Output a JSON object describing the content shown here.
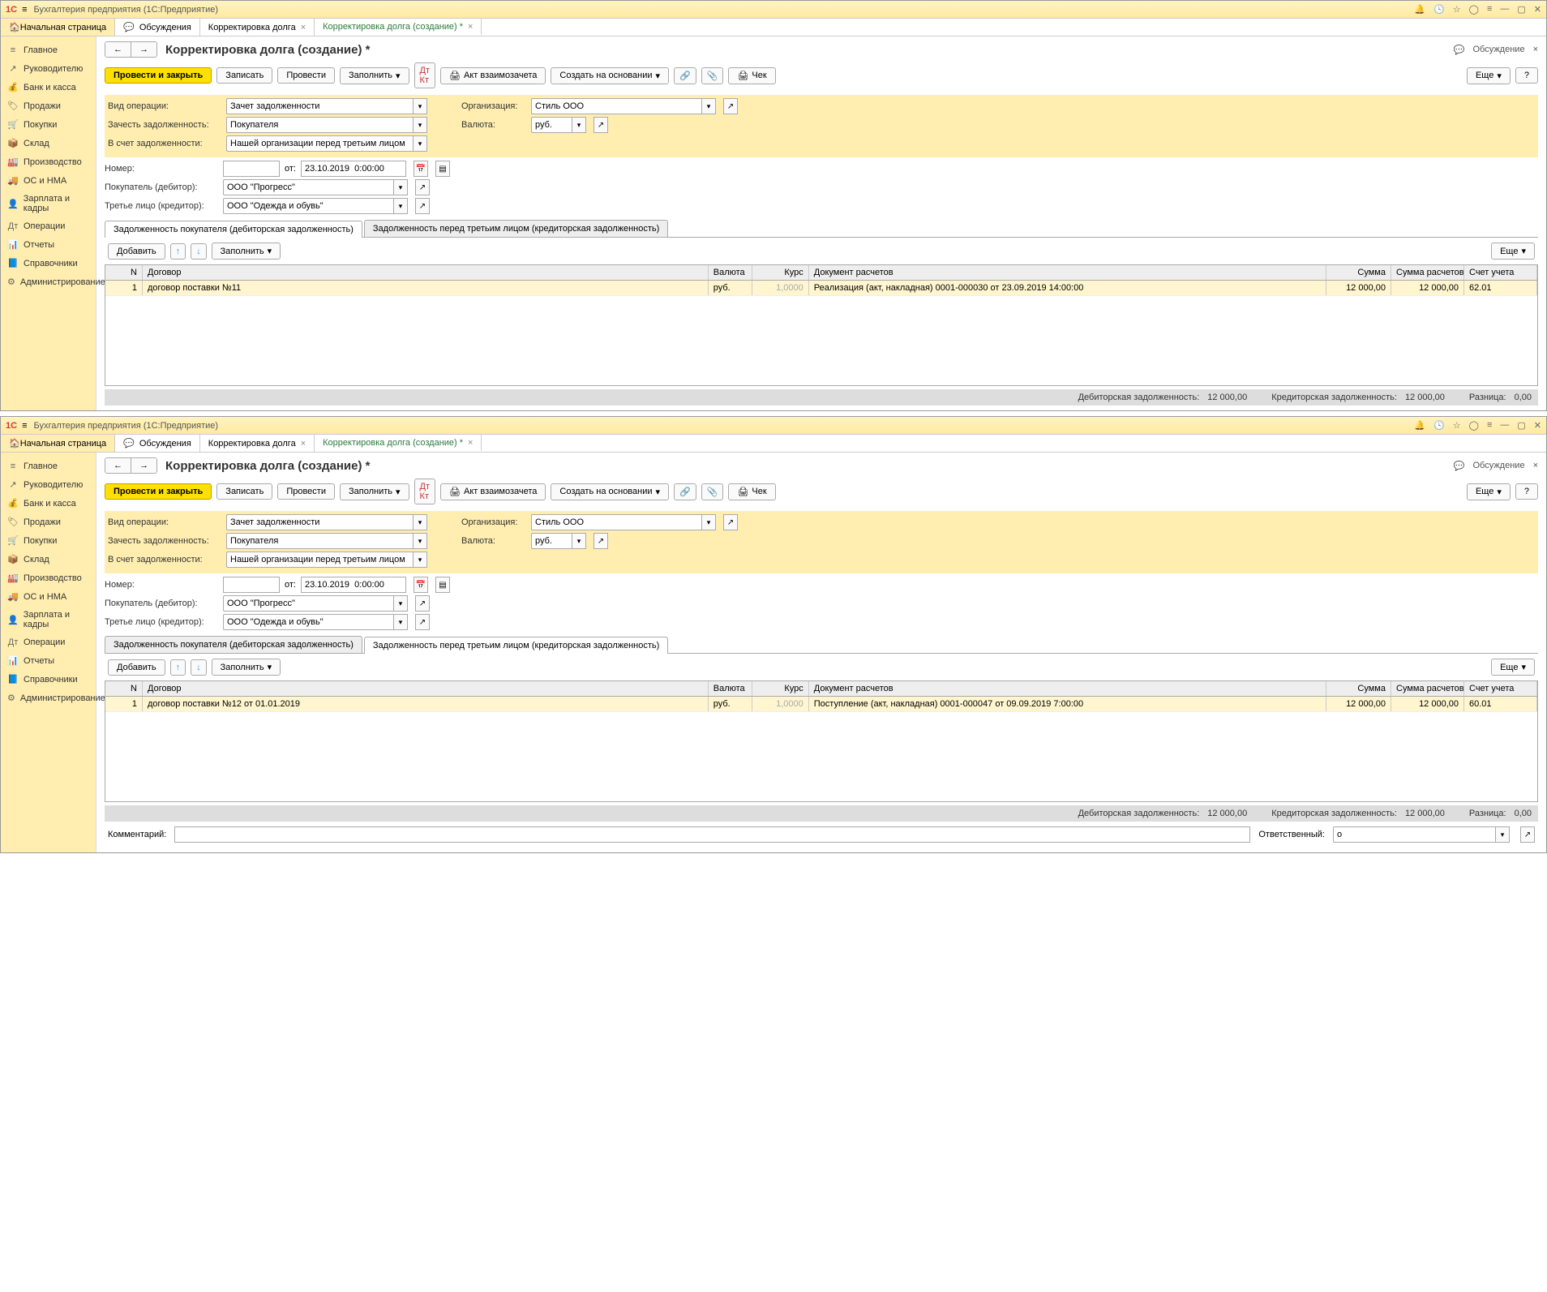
{
  "app": {
    "title": "Бухгалтерия предприятия  (1С:Предприятие)"
  },
  "home_tab": "Начальная страница",
  "tabs": [
    {
      "label": "Обсуждения"
    },
    {
      "label": "Корректировка долга"
    },
    {
      "label": "Корректировка долга (создание) *",
      "active": true
    }
  ],
  "sidebar": [
    {
      "icon": "≡",
      "label": "Главное"
    },
    {
      "icon": "↗",
      "label": "Руководителю"
    },
    {
      "icon": "💰",
      "label": "Банк и касса"
    },
    {
      "icon": "🏷",
      "label": "Продажи"
    },
    {
      "icon": "🛒",
      "label": "Покупки"
    },
    {
      "icon": "📦",
      "label": "Склад"
    },
    {
      "icon": "🏭",
      "label": "Производство"
    },
    {
      "icon": "🚚",
      "label": "ОС и НМА"
    },
    {
      "icon": "👤",
      "label": "Зарплата и кадры"
    },
    {
      "icon": "Дт",
      "label": "Операции"
    },
    {
      "icon": "📊",
      "label": "Отчеты"
    },
    {
      "icon": "📘",
      "label": "Справочники"
    },
    {
      "icon": "⚙",
      "label": "Администрирование"
    }
  ],
  "page_title": "Корректировка долга (создание) *",
  "discuss": "Обсуждение",
  "commands": {
    "post_close": "Провести и закрыть",
    "save": "Записать",
    "post": "Провести",
    "fill": "Заполнить",
    "offset": "Акт взаимозачета",
    "create_based": "Создать на основании",
    "cheque": "Чек",
    "more": "Еще",
    "help": "?"
  },
  "form": {
    "op_type_lbl": "Вид операции:",
    "op_type": "Зачет задолженности",
    "offset_lbl": "Зачесть задолженность:",
    "offset": "Покупателя",
    "against_lbl": "В счет задолженности:",
    "against": "Нашей организации перед третьим лицом",
    "number_lbl": "Номер:",
    "number": "",
    "from_lbl": "от:",
    "date": "23.10.2019  0:00:00",
    "buyer_lbl": "Покупатель (дебитор):",
    "buyer": "ООО \"Прогресс\"",
    "third_lbl": "Третье лицо (кредитор):",
    "third": "ООО \"Одежда и обувь\"",
    "org_lbl": "Организация:",
    "org": "Стиль ООО",
    "cur_lbl": "Валюта:",
    "cur": "руб."
  },
  "subtabs": {
    "receivable": "Задолженность покупателя (дебиторская задолженность)",
    "payable": "Задолженность перед третьим лицом (кредиторская задолженность)"
  },
  "grid_cmds": {
    "add": "Добавить",
    "fill": "Заполнить",
    "more": "Еще"
  },
  "grid_head": {
    "n": "N",
    "contract": "Договор",
    "cur": "Валюта",
    "rate": "Курс",
    "doc": "Документ расчетов",
    "sum": "Сумма",
    "sumr": "Сумма расчетов",
    "acc": "Счет учета"
  },
  "grid1": {
    "n": "1",
    "contract": "договор поставки №11",
    "cur": "руб.",
    "rate": "1,0000",
    "doc": "Реализация (акт, накладная) 0001-000030 от 23.09.2019 14:00:00",
    "sum": "12 000,00",
    "sumr": "12 000,00",
    "acc": "62.01"
  },
  "grid2": {
    "n": "1",
    "contract": "договор поставки №12 от 01.01.2019",
    "cur": "руб.",
    "rate": "1,0000",
    "doc": "Поступление (акт, накладная) 0001-000047 от 09.09.2019 7:00:00",
    "sum": "12 000,00",
    "sumr": "12 000,00",
    "acc": "60.01"
  },
  "status": {
    "receivable_lbl": "Дебиторская задолженность:",
    "receivable": "12 000,00",
    "payable_lbl": "Кредиторская задолженность:",
    "payable": "12 000,00",
    "diff_lbl": "Разница:",
    "diff": "0,00"
  },
  "footer": {
    "comment_lbl": "Комментарий:",
    "comment": "",
    "resp_lbl": "Ответственный:",
    "resp": "о"
  }
}
